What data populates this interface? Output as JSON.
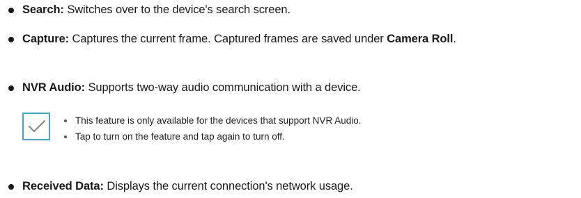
{
  "items": [
    {
      "term": "Search:",
      "desc": " Switches over to the device's search screen."
    },
    {
      "term": "Capture:",
      "desc": " Captures the current frame. Captured frames are saved under ",
      "emph": "Camera Roll",
      "tail": "."
    },
    {
      "term": "NVR Audio:",
      "desc": " Supports two-way audio communication with a device."
    },
    {
      "term": "Received Data:",
      "desc": " Displays the current connection's network usage."
    }
  ],
  "note": {
    "icon": "checkmark-icon",
    "accent_color": "#3fa9c9",
    "lines": [
      "This feature is only available for the devices that support NVR Audio.",
      "Tap to turn on the feature and tap again to turn off."
    ]
  }
}
